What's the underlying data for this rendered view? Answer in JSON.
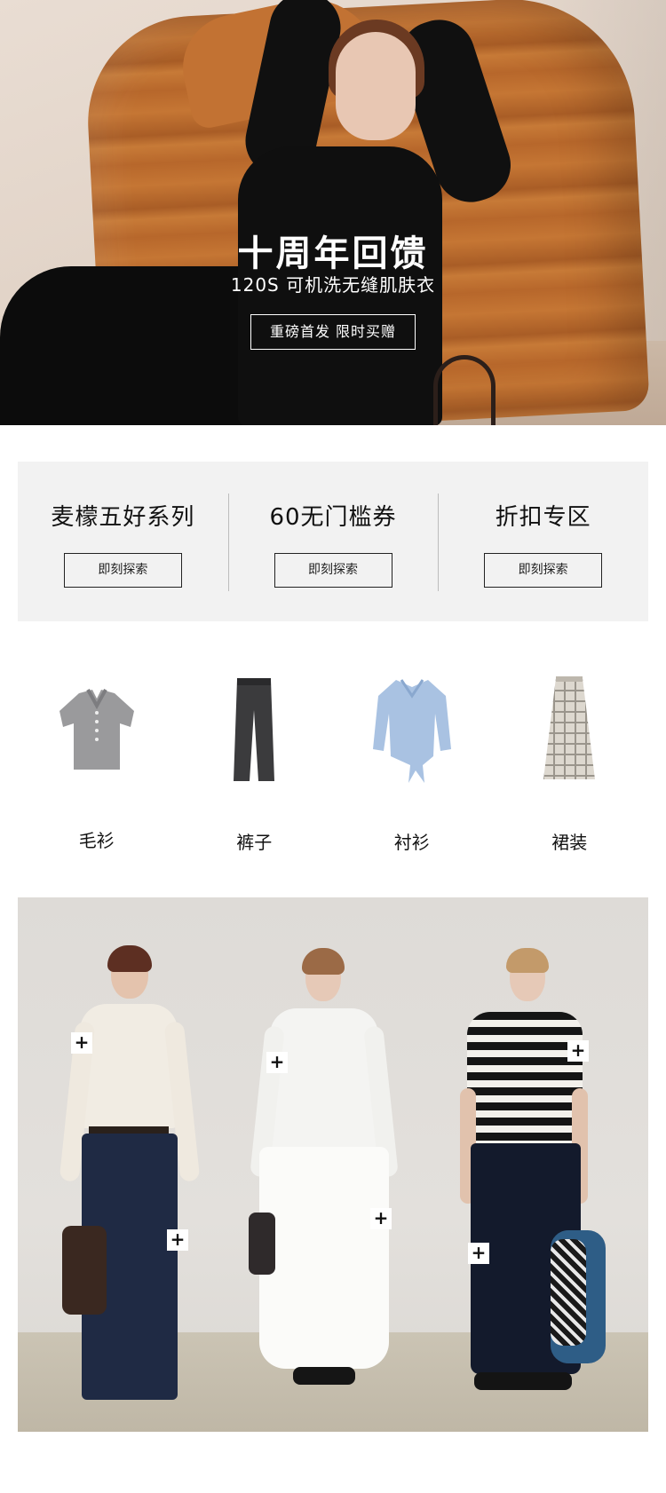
{
  "hero": {
    "title": "十周年回馈",
    "subtitle": "120S 可机洗无缝肌肤衣",
    "button_label": "重磅首发 限时买赠"
  },
  "promos": [
    {
      "title": "麦檬五好系列",
      "button_label": "即刻探索"
    },
    {
      "title": "60无门槛券",
      "button_label": "即刻探索"
    },
    {
      "title": "折扣专区",
      "button_label": "即刻探索"
    }
  ],
  "categories": [
    {
      "label": "毛衫",
      "icon": "sweater-icon"
    },
    {
      "label": "裤子",
      "icon": "pants-icon"
    },
    {
      "label": "衬衫",
      "icon": "shirt-icon"
    },
    {
      "label": "裙装",
      "icon": "skirt-icon"
    }
  ],
  "lookbook": {
    "add_icon": "+"
  },
  "colors": {
    "promo_bg": "#f2f2f2",
    "text": "#111111",
    "accent_pouf": "#b7672b"
  }
}
